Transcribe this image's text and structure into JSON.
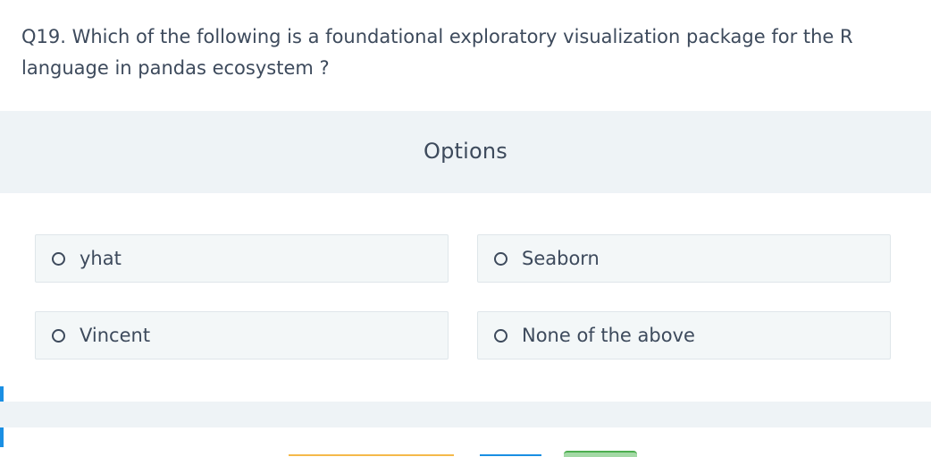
{
  "question": {
    "text": "Q19. Which of the following is a foundational exploratory visualization package for the R language in pandas ecosystem ?"
  },
  "options_header": "Options",
  "options": [
    {
      "label": "yhat"
    },
    {
      "label": "Seaborn"
    },
    {
      "label": "Vincent"
    },
    {
      "label": "None of the above"
    }
  ],
  "colors": {
    "text": "#3d4a5c",
    "band": "#eef3f6",
    "option_bg": "#f3f7f8",
    "accent_blue": "#1a8fe3",
    "accent_yellow": "#f5b94a",
    "accent_green": "#4cae4f"
  }
}
